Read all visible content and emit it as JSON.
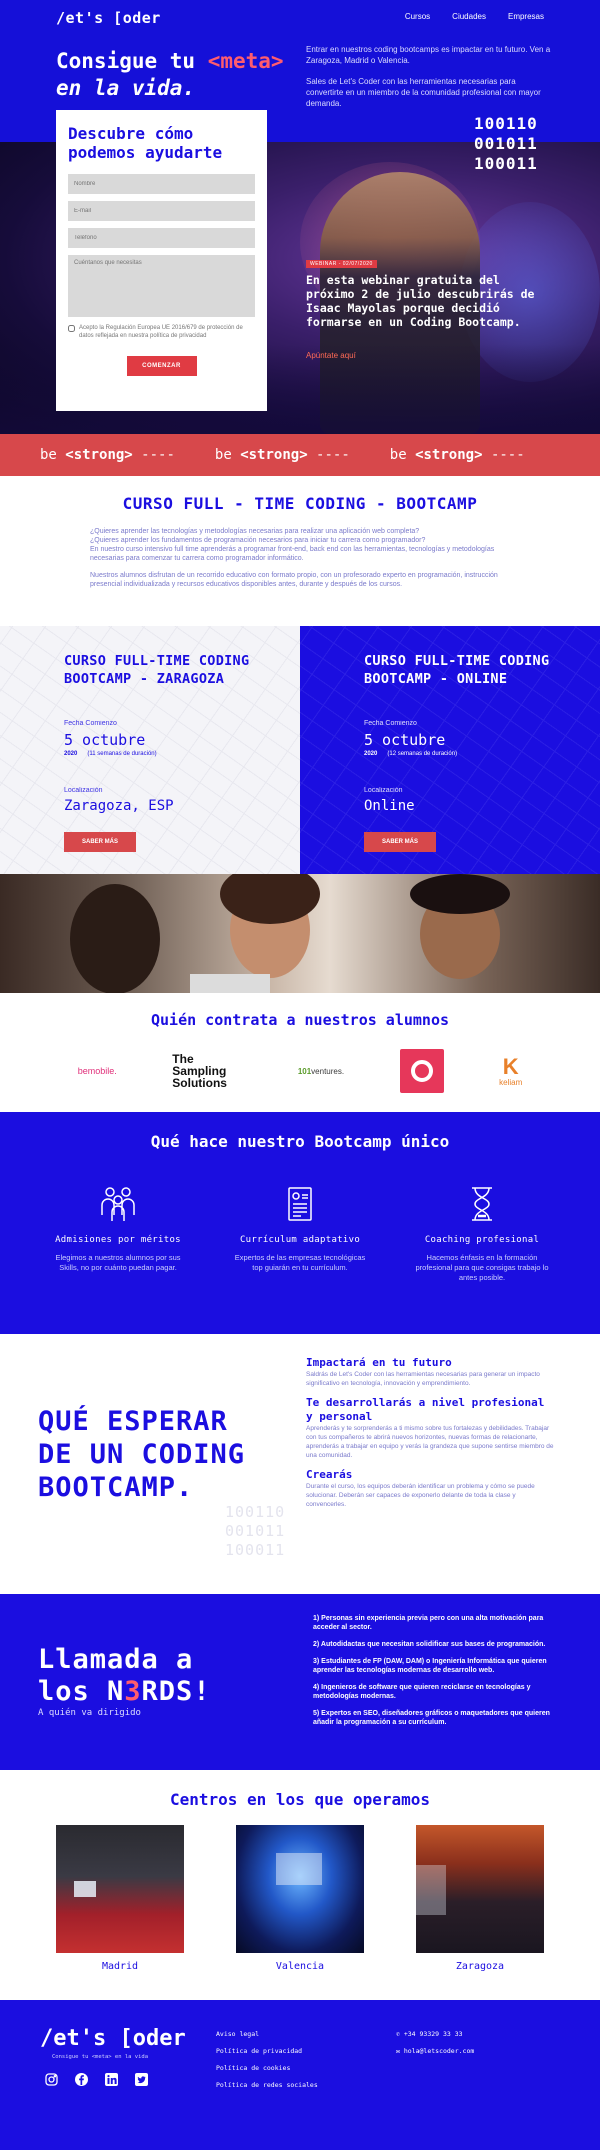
{
  "nav": {
    "logo": "/et's [oder",
    "menu": [
      "Cursos",
      "Ciudades",
      "Empresas"
    ]
  },
  "hero": {
    "title_pre": "Consigue tu ",
    "title_hl": "<meta>",
    "title_post": "en la vida.",
    "intro1": "Entrar en nuestros coding bootcamps es impactar en tu futuro. Ven a Zaragoza, Madrid o Valencia.",
    "intro2": "Sales de Let's Coder con las herramientas necesarias para convertirte en un miembro de la comunidad profesional con mayor demanda.",
    "binary": [
      "100110",
      "001011",
      "100011"
    ],
    "webinar_tag": "WEBINAR - 02/07/2020",
    "webinar_text": "En esta webinar gratuita del próximo 2 de julio descubrirás de Isaac Mayolas porque decidió formarse en un Coding Bootcamp.",
    "webinar_link": "Apúntate aquí"
  },
  "form": {
    "title": "Descubre cómo podemos ayudarte",
    "name_ph": "Nombre",
    "email_ph": "E-mail",
    "phone_ph": "Teléfono",
    "message_ph": "Cuéntanos que necesitas",
    "consent": "Acepto la Regulación Europea UE 2016/679 de protección de datos reflejada en nuestra política de privacidad",
    "submit": "COMENZAR"
  },
  "marquee": {
    "pre": "be ",
    "tag": "<strong>",
    "sep": " ----"
  },
  "intro": {
    "title_a": "CURSO FULL - ",
    "title_b": "TIME CODING",
    "title_c": " - BOOTCAMP",
    "p1": "¿Quieres aprender las tecnologías y metodologías necesarias para realizar una aplicación web completa?",
    "p2": "¿Quieres aprender los fundamentos de programación necesarios para iniciar tu carrera como programador?",
    "p3": "En nuestro curso intensivo full time aprenderás a programar front-end, back end con las herramientas, tecnologías y metodologías necesarias para comenzar tu carrera como programador informático.",
    "p4": "Nuestros alumnos disfrutan de un recorrido educativo con formato propio, con un profesorado experto en programación, instrucción presencial individualizada y recursos educativos disponibles antes, durante y después de los cursos."
  },
  "courses": [
    {
      "title": "CURSO FULL-TIME CODING BOOTCAMP - ",
      "city": "ZARAGOZA",
      "start_label": "Fecha Comienzo",
      "date": "5 octubre",
      "year": "2020",
      "duration": "(11 semanas de duración)",
      "loc_label": "Localización",
      "location": "Zaragoza, ESP",
      "button": "SABER MÁS"
    },
    {
      "title": "CURSO FULL-TIME CODING BOOTCAMP - ",
      "city": "ONLINE",
      "start_label": "Fecha Comienzo",
      "date": "5 octubre",
      "year": "2020",
      "duration": "(12 semanas de duración)",
      "loc_label": "Localización",
      "location": "Online",
      "button": "SABER MÁS"
    }
  ],
  "clients": {
    "title": "Quién contrata a nuestros alumnos",
    "bemobile": "bemobile.",
    "sampling": "The Sampling Solutions",
    "ventures_a": "101",
    "ventures_b": "ventures.",
    "keliam": "keliam"
  },
  "features": {
    "title": "Qué hace nuestro Bootcamp único",
    "items": [
      {
        "title": "Admisiones por méritos",
        "desc": "Elegimos a nuestros alumnos por sus Skills, no por cuánto puedan pagar."
      },
      {
        "title": "Currículum adaptativo",
        "desc": "Expertos de las empresas tecnológicas top guiarán en tu currículum."
      },
      {
        "title": "Coaching profesional",
        "desc": "Hacemos énfasis en la formación profesional para que consigas trabajo lo antes posible."
      }
    ]
  },
  "expect": {
    "title": "QUÉ ESPERAR DE UN CODING BOOTCAMP.",
    "binary": [
      "100110",
      "001011",
      "100011"
    ],
    "items": [
      {
        "title": "Impactará en tu futuro",
        "desc": "Saldrás de Let's Coder con las herramientas necesarias para generar un impacto significativo en tecnología, innovación y emprendimiento."
      },
      {
        "title": "Te desarrollarás a nivel profesional y personal",
        "desc": "Aprenderás y te sorprenderás a ti mismo sobre tus fortalezas y debilidades. Trabajar con tus compañeros te abrirá nuevos horizontes, nuevas formas de relacionarte, aprenderás a trabajar en equipo y verás la grandeza que supone sentirse miembro de una comunidad."
      },
      {
        "title": "Crearás",
        "desc": "Durante el curso, los equipos deberán identificar un problema y cómo se puede solucionar. Deberán ser capaces de exponerlo delante de toda la clase y convencerles."
      }
    ]
  },
  "nerds": {
    "title_a": "Llamada a",
    "title_b": "los N",
    "title_three": "3",
    "title_c": "RDS!",
    "subtitle": "A quién va dirigido",
    "items": [
      "1) Personas sin experiencia previa pero con una alta motivación para acceder al sector.",
      "2) Autodidactas que necesitan solidificar sus bases de programación.",
      "3) Estudiantes de FP (DAW, DAM) o Ingeniería Informática que quieren aprender las tecnologías modernas de desarrollo web.",
      "4) Ingenieros de software que quieren reciclarse en tecnologías y metodologías modernas.",
      "5) Expertos en SEO, diseñadores gráficos o maquetadores que quieren añadir la programación a su currículum."
    ]
  },
  "centers": {
    "title": "Centros en los que operamos",
    "items": [
      "Madrid",
      "Valencia",
      "Zaragoza"
    ]
  },
  "footer": {
    "logo": "/et's [oder",
    "tagline": "Consigue tu <meta> en la vida",
    "links": [
      "Aviso legal",
      "Política de privacidad",
      "Política de cookies",
      "Política de redes sociales"
    ],
    "phone": "+34 93329 33 33",
    "email": "hola@letscoder.com",
    "social_icons": [
      "instagram-icon",
      "facebook-icon",
      "linkedin-icon",
      "twitter-icon"
    ]
  },
  "colors": {
    "brand_blue": "#1b0ee0",
    "accent_red": "#d7484b",
    "highlight_pink": "#ff5c6e"
  }
}
